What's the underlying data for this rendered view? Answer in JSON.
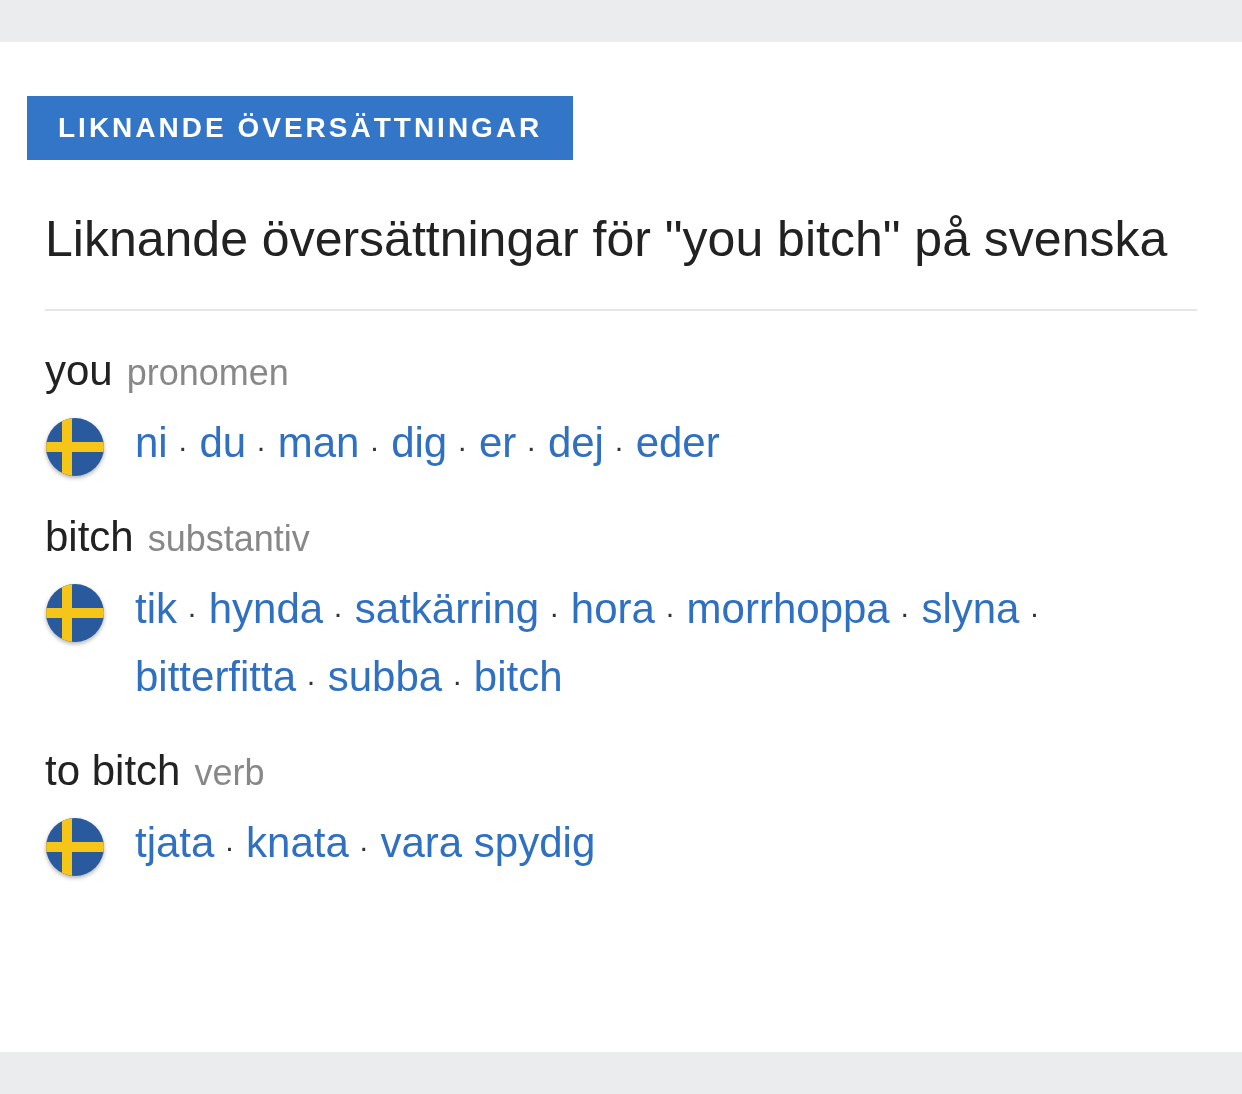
{
  "badge": "LIKNANDE ÖVERSÄTTNINGAR",
  "heading": "Liknande översättningar för \"you bitch\" på svenska",
  "separator": "·",
  "groups": [
    {
      "term": "you",
      "pos": "pronomen",
      "translations": [
        "ni",
        "du",
        "man",
        "dig",
        "er",
        "dej",
        "eder"
      ]
    },
    {
      "term": "bitch",
      "pos": "substantiv",
      "translations": [
        "tik",
        "hynda",
        "satkärring",
        "hora",
        "morrhoppa",
        "slyna",
        "bitterfitta",
        "subba",
        "bitch"
      ]
    },
    {
      "term": "to bitch",
      "pos": "verb",
      "translations": [
        "tjata",
        "knata",
        "vara spydig"
      ]
    }
  ]
}
